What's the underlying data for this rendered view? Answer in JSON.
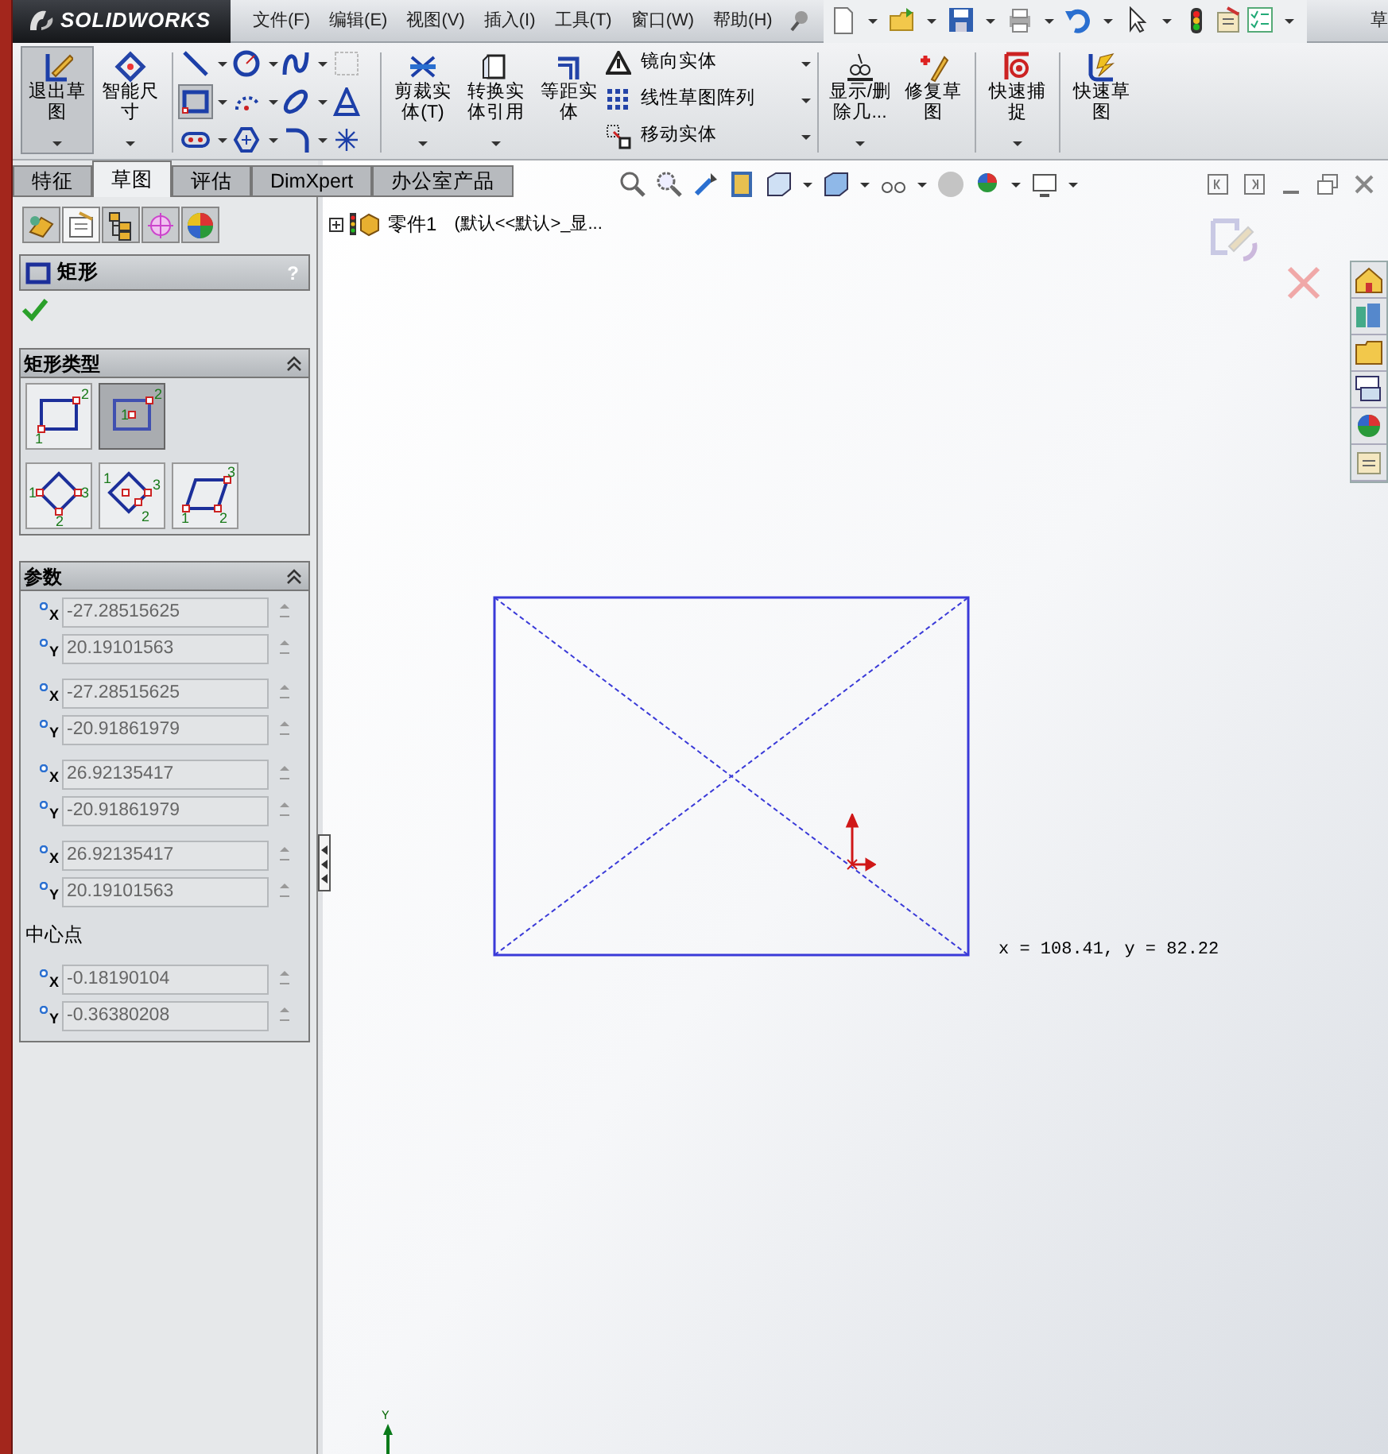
{
  "app": {
    "logo": "SOLIDWORKS",
    "mode_label": "草"
  },
  "menu": [
    "文件(F)",
    "编辑(E)",
    "视图(V)",
    "插入(I)",
    "工具(T)",
    "窗口(W)",
    "帮助(H)"
  ],
  "ribbon": [
    {
      "kind": "large",
      "label": "退出草图",
      "pressed": true,
      "dropdown": true
    },
    {
      "kind": "large",
      "label": "智能尺寸",
      "pressed": false,
      "dropdown": true
    },
    {
      "kind": "tools"
    },
    {
      "kind": "large",
      "label": "剪裁实体(T)",
      "pressed": false,
      "dropdown": true
    },
    {
      "kind": "large",
      "label": "转换实体引用",
      "pressed": false,
      "dropdown": true
    },
    {
      "kind": "large",
      "label": "等距实体",
      "pressed": false,
      "dropdown": false
    },
    {
      "kind": "list",
      "items": [
        {
          "label": "镜向实体"
        },
        {
          "label": "线性草图阵列"
        },
        {
          "label": "移动实体"
        }
      ]
    },
    {
      "kind": "large",
      "label": "显示/删除几...",
      "pressed": false,
      "dropdown": true
    },
    {
      "kind": "large",
      "label": "修复草图",
      "pressed": false,
      "dropdown": false
    },
    {
      "kind": "large",
      "label": "快速捕捉",
      "pressed": false,
      "dropdown": true
    },
    {
      "kind": "large",
      "label": "快速草图",
      "pressed": false,
      "dropdown": false
    }
  ],
  "sketch_tools": [
    {
      "kind": "line",
      "selected": false
    },
    {
      "kind": "circle",
      "selected": false
    },
    {
      "kind": "spline",
      "selected": false
    },
    {
      "kind": "grid",
      "selected": false
    },
    {
      "kind": "rectangle",
      "selected": true
    },
    {
      "kind": "arc",
      "selected": false
    },
    {
      "kind": "ellipse",
      "selected": false
    },
    {
      "kind": "text",
      "selected": false
    },
    {
      "kind": "slot",
      "selected": false
    },
    {
      "kind": "polygon",
      "selected": false
    },
    {
      "kind": "fillet",
      "selected": false
    },
    {
      "kind": "point",
      "selected": false
    }
  ],
  "tabs": [
    {
      "label": "特征",
      "selected": false
    },
    {
      "label": "草图",
      "selected": true
    },
    {
      "label": "评估",
      "selected": false
    },
    {
      "label": "DimXpert",
      "selected": false
    },
    {
      "label": "办公室产品",
      "selected": false
    }
  ],
  "panel_tabs": [
    {
      "selected": false
    },
    {
      "selected": true
    },
    {
      "selected": false
    },
    {
      "selected": false
    },
    {
      "selected": false
    }
  ],
  "panel": {
    "title": "矩形",
    "help": "?",
    "rectangle_types": {
      "title": "矩形类型",
      "options": [
        {
          "kind": "corner",
          "selected": false,
          "points": [
            "1",
            "2"
          ]
        },
        {
          "kind": "center",
          "selected": true,
          "points": [
            "1",
            "2"
          ]
        },
        {
          "kind": "corner3",
          "selected": false,
          "points": [
            "1",
            "2",
            "3"
          ]
        },
        {
          "kind": "center3",
          "selected": false,
          "points": [
            "1",
            "2",
            "3"
          ]
        },
        {
          "kind": "parallelogram",
          "selected": false,
          "points": [
            "1",
            "2",
            "3"
          ]
        }
      ]
    },
    "parameters": {
      "title": "参数",
      "groups": [
        {
          "fields": [
            {
              "axis": "X",
              "value": "-27.28515625"
            },
            {
              "axis": "Y",
              "value": "20.19101563"
            }
          ]
        },
        {
          "fields": [
            {
              "axis": "X",
              "value": "-27.28515625"
            },
            {
              "axis": "Y",
              "value": "-20.91861979"
            }
          ]
        },
        {
          "fields": [
            {
              "axis": "X",
              "value": "26.92135417"
            },
            {
              "axis": "Y",
              "value": "-20.91861979"
            }
          ]
        },
        {
          "fields": [
            {
              "axis": "X",
              "value": "26.92135417"
            },
            {
              "axis": "Y",
              "value": "20.19101563"
            }
          ]
        },
        {
          "label": "中心点",
          "fields": [
            {
              "axis": "X",
              "value": "-0.18190104"
            },
            {
              "axis": "Y",
              "value": "-0.36380208"
            }
          ]
        }
      ]
    }
  },
  "tree": {
    "name": "零件1",
    "config": "(默认<<默认>_显..."
  },
  "viewport": {
    "cursor_coords": "x = 108.41, y = 82.22",
    "axis_label": "Y"
  }
}
